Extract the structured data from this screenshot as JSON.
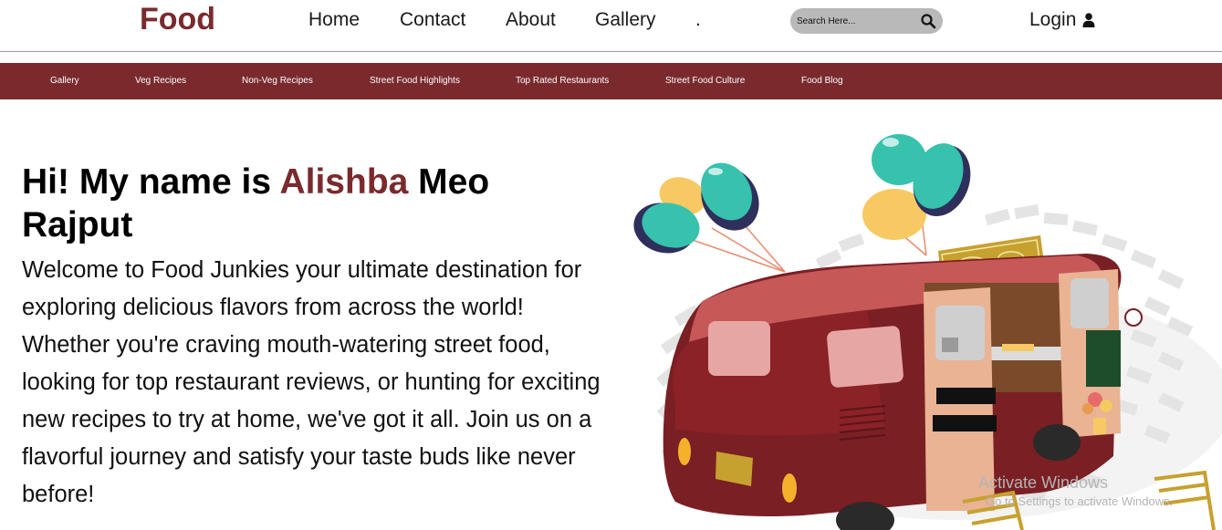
{
  "header": {
    "brand": "Food",
    "nav": [
      {
        "label": "Home"
      },
      {
        "label": "Contact"
      },
      {
        "label": "About"
      },
      {
        "label": "Gallery"
      },
      {
        "label": "."
      }
    ],
    "search_placeholder": "Search Here...",
    "login_label": "Login"
  },
  "subnav": [
    {
      "label": "Gallery"
    },
    {
      "label": "Veg Recipes"
    },
    {
      "label": "Non-Veg Recipes"
    },
    {
      "label": "Street Food Highlights"
    },
    {
      "label": "Top Rated Restaurants"
    },
    {
      "label": "Street Food Culture"
    },
    {
      "label": "Food Blog"
    }
  ],
  "hero": {
    "title_prefix": "Hi! My name is ",
    "title_name": "Alishba",
    "title_suffix": " Meo Rajput",
    "body": "Welcome to Food Junkies your ultimate destination for exploring delicious flavors from across the world! Whether you're craving mouth-watering street food, looking for top restaurant reviews, or hunting for exciting new recipes to try at home, we've got it all. Join us on a flavorful journey and satisfy your taste buds like never before!"
  },
  "os_watermark": {
    "line1": "Activate Windows",
    "line2": "Go to Settings to activate Windows."
  },
  "colors": {
    "brand": "#7a2a2d",
    "search_bg": "#b9b9b9",
    "teal": "#36c2ad",
    "yellow": "#f6c962",
    "navy": "#2f2f5c"
  },
  "icons": {
    "search": "magnifier",
    "login": "user-silhouette"
  }
}
